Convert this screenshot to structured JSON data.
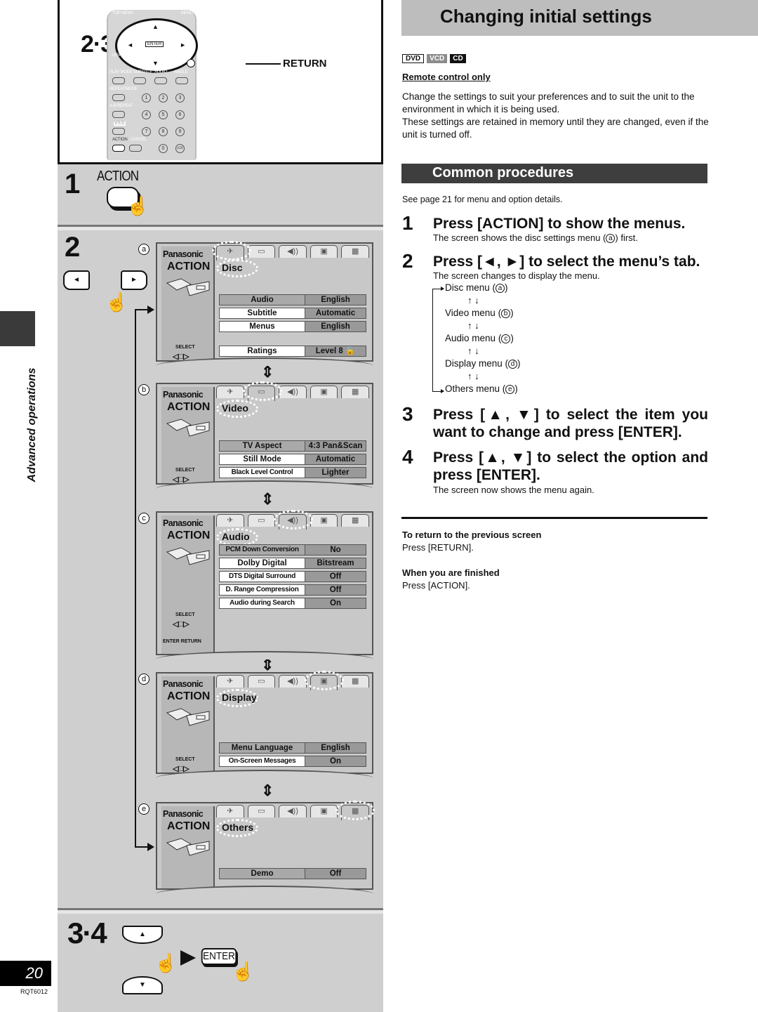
{
  "left": {
    "remote": {
      "callout_234": "2·3·4",
      "callout_1": "1",
      "return_callout": "RETURN",
      "labels": {
        "top_menu": "TOP MENU",
        "menu": "MENU",
        "display": "DISPLAY",
        "return": "RETURN",
        "play_mode": "PLAY MODE",
        "subtitle": "SUBTITLE",
        "audio": "AUDIO",
        "angle": "ANGLE",
        "repeat_mode": "REPEATMODE",
        "ab_repeat": "A-B REPEAT",
        "vss": "V.S.S.",
        "action": "ACTION",
        "cancel": "CANCEL",
        "enter": "ENTER"
      },
      "numbers": [
        "1",
        "2",
        "3",
        "4",
        "5",
        "6",
        "7",
        "8",
        "9",
        "0",
        "≥10"
      ]
    },
    "step1": {
      "num": "1",
      "button_label": "ACTION"
    },
    "step2": {
      "num": "2",
      "left_key": "◄",
      "right_key": "►"
    },
    "screens": [
      {
        "letter": "a",
        "brand": "Panasonic",
        "action": "ACTION",
        "title": "Disc",
        "active_tab": 0,
        "select_hint": "SELECT",
        "rows": [
          {
            "label": "Audio",
            "value": "English",
            "highlight": true
          },
          {
            "label": "Subtitle",
            "value": "Automatic"
          },
          {
            "label": "Menus",
            "value": "English"
          },
          {
            "label": "Ratings",
            "value": "Level 8 🔓",
            "gap": true
          }
        ]
      },
      {
        "letter": "b",
        "brand": "Panasonic",
        "action": "ACTION",
        "title": "Video",
        "active_tab": 1,
        "select_hint": "SELECT",
        "rows": [
          {
            "label": "TV Aspect",
            "value": "4:3 Pan&Scan",
            "highlight": true
          },
          {
            "label": "Still Mode",
            "value": "Automatic"
          },
          {
            "label": "Black Level Control",
            "value": "Lighter",
            "small": true
          }
        ]
      },
      {
        "letter": "c",
        "brand": "Panasonic",
        "action": "ACTION",
        "title": "Audio",
        "active_tab": 2,
        "select_hint": "SELECT",
        "enter_return_hint": "ENTER RETURN",
        "rows": [
          {
            "label": "PCM Down Conversion",
            "value": "No",
            "highlight": true,
            "small": true
          },
          {
            "label": "Dolby Digital",
            "value": "Bitstream"
          },
          {
            "label": "DTS Digital Surround",
            "value": "Off",
            "small": true
          },
          {
            "label": "D. Range Compression",
            "value": "Off",
            "small": true
          },
          {
            "label": "Audio during Search",
            "value": "On",
            "small": true
          }
        ]
      },
      {
        "letter": "d",
        "brand": "Panasonic",
        "action": "ACTION",
        "title": "Display",
        "active_tab": 3,
        "select_hint": "SELECT",
        "rows": [
          {
            "label": "Menu Language",
            "value": "English",
            "highlight": true
          },
          {
            "label": "On-Screen Messages",
            "value": "On",
            "small": true
          }
        ]
      },
      {
        "letter": "e",
        "brand": "Panasonic",
        "action": "ACTION",
        "title": "Others",
        "active_tab": 4,
        "rows": [
          {
            "label": "Demo",
            "value": "Off",
            "highlight": true
          }
        ]
      }
    ],
    "tab_icons": [
      "disc-icon",
      "video-screen-icon",
      "speaker-icon",
      "display-icon",
      "others-blocks-icon"
    ],
    "step34": {
      "num": "3·4",
      "up_key": "▲",
      "down_key": "▼",
      "enter_label": "ENTER"
    },
    "side_tab": "Advanced operations",
    "page_number": "20",
    "doc_code": "RQT6012"
  },
  "right": {
    "title": "Changing initial settings",
    "badges": [
      "DVD",
      "VCD",
      "CD"
    ],
    "remote_only": "Remote control only",
    "intro_lines": [
      "Change the settings to suit your preferences and to suit the unit to the environment in which it is being used.",
      "These settings are retained in memory until they are changed, even if the unit is turned off."
    ],
    "subheading": "Common procedures",
    "see_page": "See page 21 for menu and option details.",
    "steps": [
      {
        "num": "1",
        "heading": "Press [ACTION] to show the menus.",
        "desc_pre": "The screen shows the disc settings menu (",
        "desc_letter": "a",
        "desc_post": ") first."
      },
      {
        "num": "2",
        "heading": "Press [◄, ►] to select the menu’s tab.",
        "desc": "The screen changes to display the menu."
      },
      {
        "num": "3",
        "heading": "Press [▲, ▼] to select the item you want to change and press [ENTER]."
      },
      {
        "num": "4",
        "heading": "Press [▲, ▼] to select the option and press [ENTER].",
        "desc": "The screen now shows the menu again."
      }
    ],
    "menu_cycle": [
      {
        "name": "Disc menu",
        "letter": "a"
      },
      {
        "name": "Video menu",
        "letter": "b"
      },
      {
        "name": "Audio menu",
        "letter": "c"
      },
      {
        "name": "Display menu",
        "letter": "d"
      },
      {
        "name": "Others menu",
        "letter": "e"
      }
    ],
    "cycle_arrows": "↑ ↓",
    "notes": [
      {
        "heading": "To return to the previous screen",
        "body": "Press [RETURN]."
      },
      {
        "heading": "When you are finished",
        "body": "Press [ACTION]."
      }
    ]
  }
}
